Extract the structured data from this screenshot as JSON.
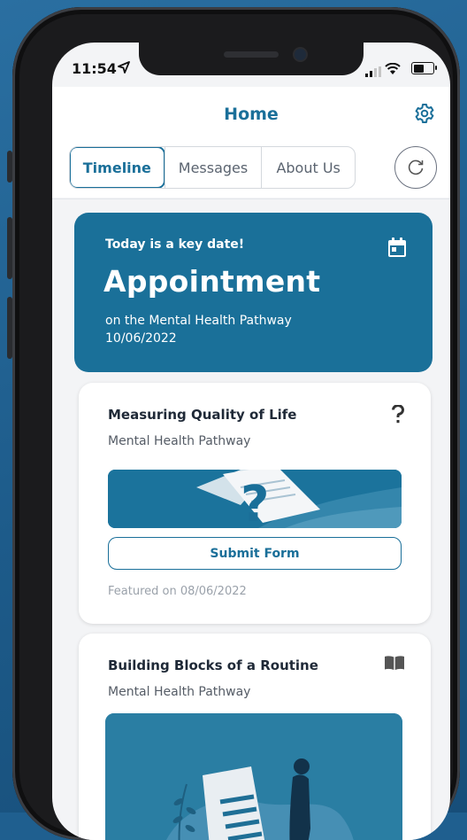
{
  "status_bar": {
    "time": "11:54"
  },
  "header": {
    "title": "Home",
    "tabs": [
      {
        "label": "Timeline",
        "active": true
      },
      {
        "label": "Messages",
        "active": false
      },
      {
        "label": "About Us",
        "active": false
      }
    ]
  },
  "key_date": {
    "label": "Today is a key date!",
    "title": "Appointment",
    "subtitle": "on the Mental Health Pathway",
    "date": "10/06/2022"
  },
  "cards": [
    {
      "title": "Measuring Quality of Life",
      "subtitle": "Mental Health Pathway",
      "icon": "question-icon",
      "button_label": "Submit Form",
      "featured": "Featured on 08/06/2022"
    },
    {
      "title": "Building Blocks of a Routine",
      "subtitle": "Mental Health Pathway",
      "icon": "book-icon"
    }
  ],
  "colors": {
    "accent": "#1a7099",
    "background": "#f3f4f6"
  }
}
